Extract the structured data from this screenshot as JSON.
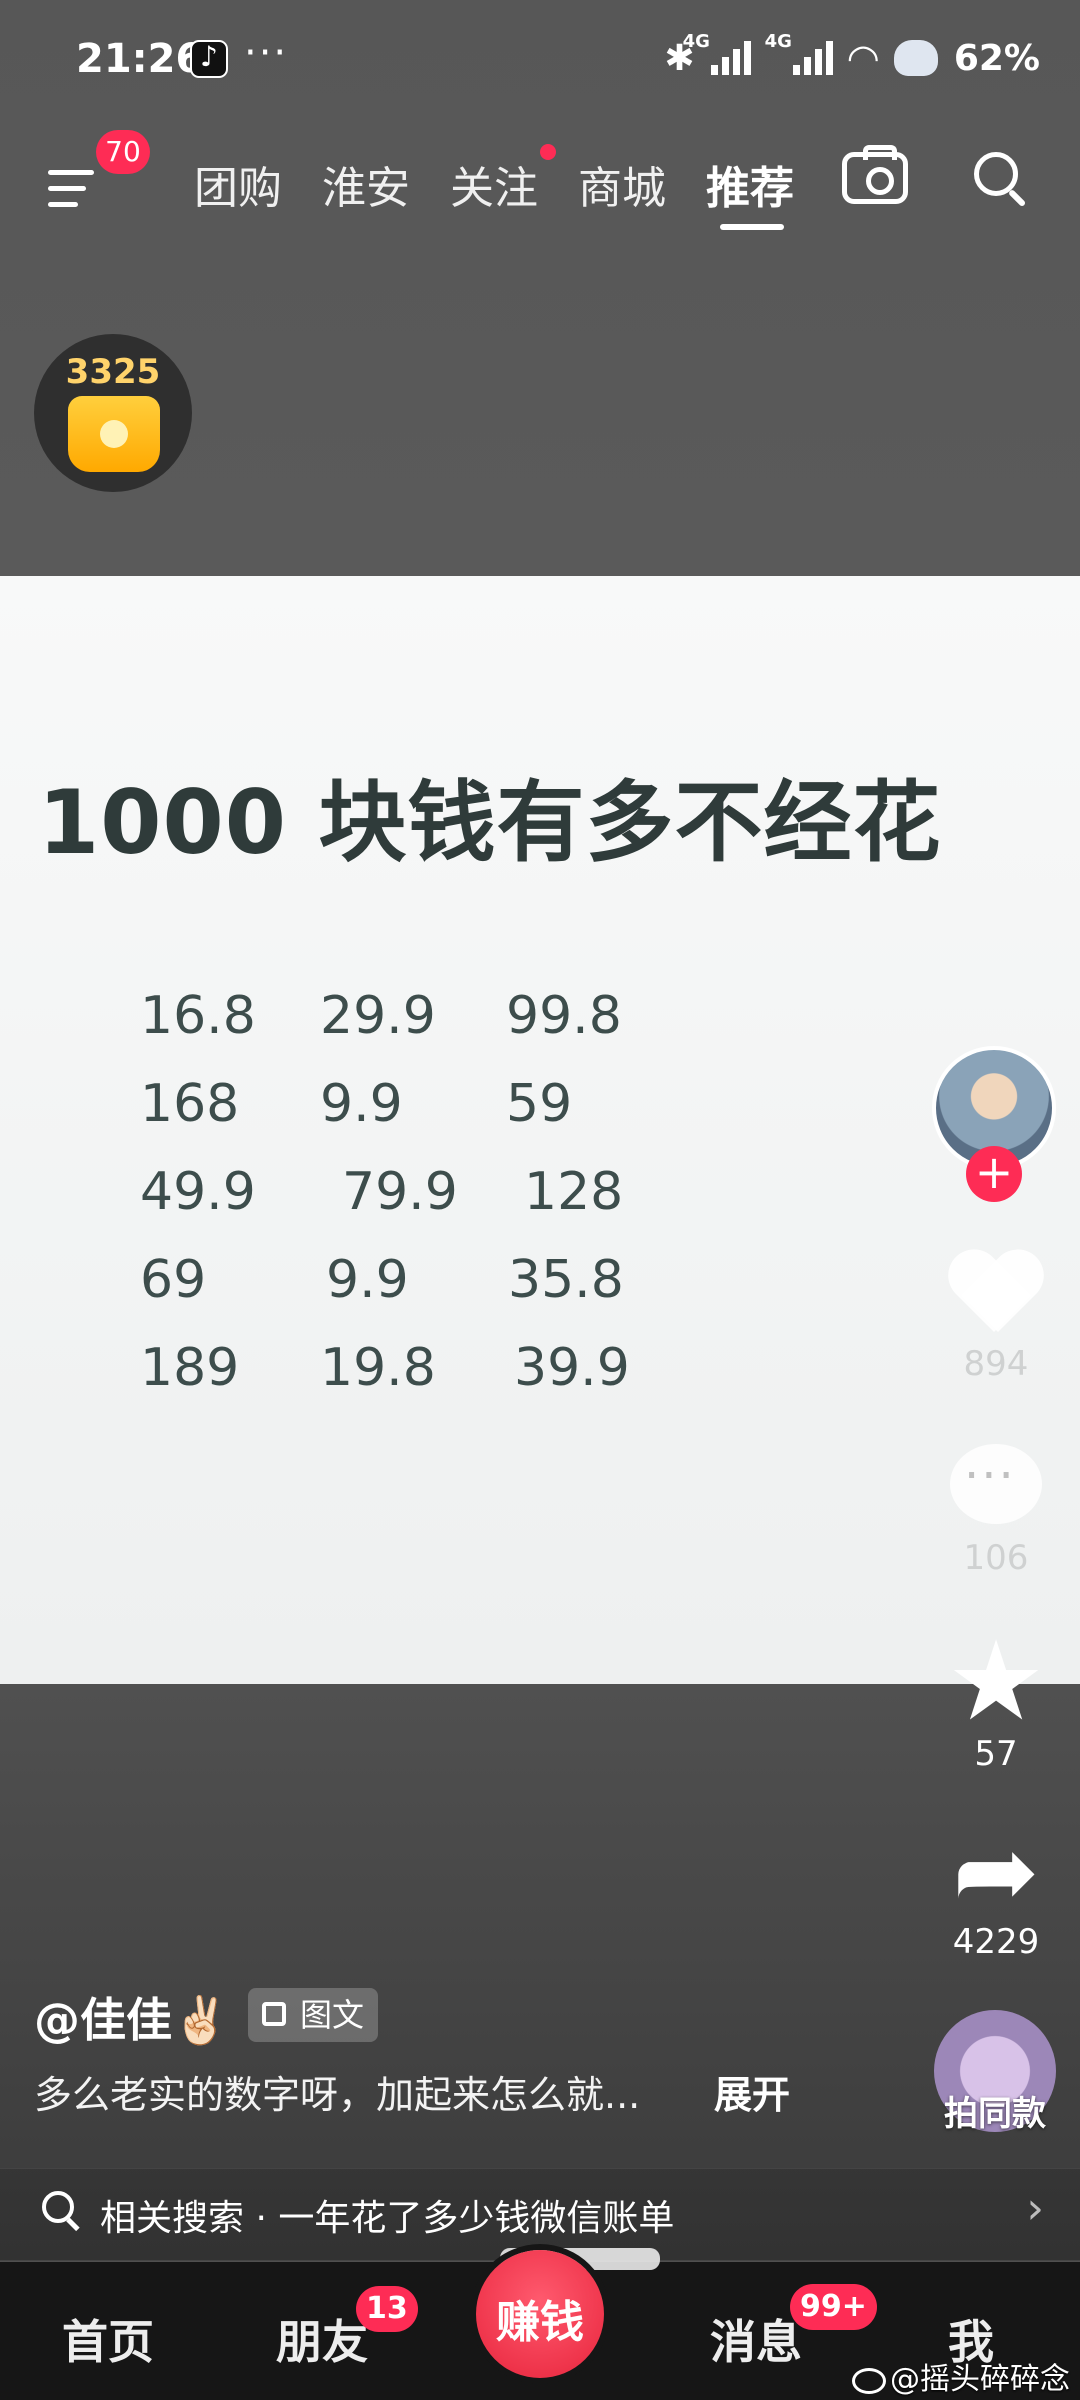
{
  "status_bar": {
    "time": "21:26",
    "more": "···",
    "sig1": "4G",
    "sig2": "4G",
    "battery": "62%"
  },
  "nav": {
    "menu_badge": "70",
    "tabs": [
      "团购",
      "淮安",
      "关注",
      "商城",
      "推荐"
    ],
    "active_tab": "推荐"
  },
  "coin_widget": {
    "count": "3325"
  },
  "post": {
    "title": "1000 块钱有多不经花",
    "numbers": [
      [
        "16.8",
        "29.9",
        "99.8"
      ],
      [
        "168",
        "9.9",
        "59"
      ],
      [
        "49.9",
        "79.9",
        "128"
      ],
      [
        "69",
        "9.9",
        "35.8"
      ],
      [
        "189",
        "19.8",
        "39.9"
      ]
    ]
  },
  "actions": {
    "likes": "894",
    "comments": "106",
    "favorites": "57",
    "shares": "4229",
    "same_style": "拍同款"
  },
  "author": {
    "name": "@佳佳✌🏻",
    "tag": "图文"
  },
  "caption": {
    "text": "多么老实的数字呀，加起来怎么就...",
    "expand": "展开"
  },
  "related": {
    "text": "相关搜索 · 一年花了多少钱微信账单"
  },
  "bottom_nav": {
    "home": "首页",
    "friends": "朋友",
    "friends_badge": "13",
    "earn": "赚钱",
    "messages": "消息",
    "messages_badge": "99+",
    "me": "我"
  },
  "watermark": "@摇头碎碎念",
  "colors": {
    "accent": "#fe2c55",
    "title_text": "#2f3b3a",
    "number_text": "#3d4d4c"
  }
}
